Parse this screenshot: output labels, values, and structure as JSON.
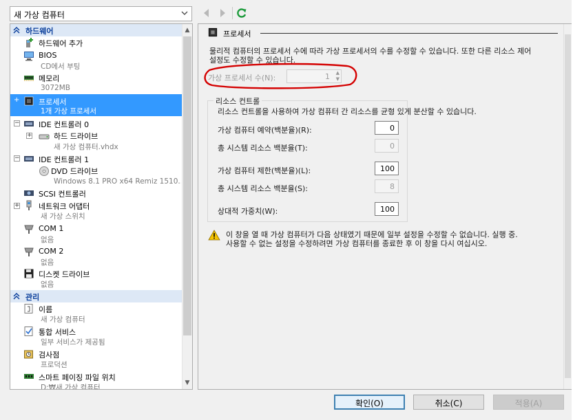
{
  "vm_selector": {
    "value": "새 가상 컴퓨터"
  },
  "toolbar": {
    "back": "back",
    "forward": "forward",
    "refresh": "refresh"
  },
  "sidebar": {
    "hardware_header": "하드웨어",
    "management_header": "관리",
    "items": [
      {
        "name": "하드웨어 추가",
        "sub": ""
      },
      {
        "name": "BIOS",
        "sub": "CD에서 부팅"
      },
      {
        "name": "메모리",
        "sub": "3072MB"
      },
      {
        "name": "프로세서",
        "sub": "1개 가상 프로세서"
      },
      {
        "name": "IDE 컨트롤러 0",
        "sub": ""
      },
      {
        "name": "하드 드라이브",
        "sub": "새 가상 컴퓨터.vhdx"
      },
      {
        "name": "IDE 컨트롤러 1",
        "sub": ""
      },
      {
        "name": "DVD 드라이브",
        "sub": "Windows 8.1 PRO x64 Remiz 1510...."
      },
      {
        "name": "SCSI 컨트롤러",
        "sub": ""
      },
      {
        "name": "네트워크 어댑터",
        "sub": "새 가상 스위치"
      },
      {
        "name": "COM 1",
        "sub": "없음"
      },
      {
        "name": "COM 2",
        "sub": "없음"
      },
      {
        "name": "디스켓 드라이브",
        "sub": "없음"
      },
      {
        "name": "이름",
        "sub": "새 가상 컴퓨터"
      },
      {
        "name": "통합 서비스",
        "sub": "일부 서비스가 제공됨"
      },
      {
        "name": "검사점",
        "sub": "프로덕션"
      },
      {
        "name": "스마트 페이징 파일 위치",
        "sub": "D:₩새 가상 컴퓨터"
      }
    ]
  },
  "processor": {
    "title": "프로세서",
    "description_line1": "물리적 컴퓨터의 프로세서 수에 따라 가상 프로세서의 수를 수정할 수 있습니다. 또한 다른 리소스 제어",
    "description_line2": "설정도 수정할 수 있습니다.",
    "count_label": "가상 프로세서 수(N):",
    "count_value": "1",
    "resource_control": {
      "title": "리소스 컨트롤",
      "description": "리소스 컨트롤을 사용하여 가상 컴퓨터 간 리소스를 균형 있게 분산할 수 있습니다.",
      "fields": [
        {
          "label": "가상 컴퓨터 예약(백분율)(R):",
          "value": "0",
          "enabled": true
        },
        {
          "label": "총 시스템 리소스 백분율(T):",
          "value": "0",
          "enabled": false
        },
        {
          "label": "가상 컴퓨터 제한(백분율)(L):",
          "value": "100",
          "enabled": true
        },
        {
          "label": "총 시스템 리소스 백분율(S):",
          "value": "8",
          "enabled": false
        },
        {
          "label": "상대적 가중치(W):",
          "value": "100",
          "enabled": true
        }
      ]
    },
    "warning_line1": "이 창을 열 때 가상 컴퓨터가 다음 상태였기 때문에 일부 설정을 수정할 수 없습니다. 실행 중.",
    "warning_line2": "사용할 수 없는 설정을 수정하려면 가상 컴퓨터를 종료한 후 이 창을 다시 여십시오."
  },
  "buttons": {
    "ok": "확인(O)",
    "cancel": "취소(C)",
    "apply": "적용(A)"
  },
  "colors": {
    "selection": "#3399ff",
    "annotation": "#d40000",
    "section_header": "#0b3f9b"
  }
}
